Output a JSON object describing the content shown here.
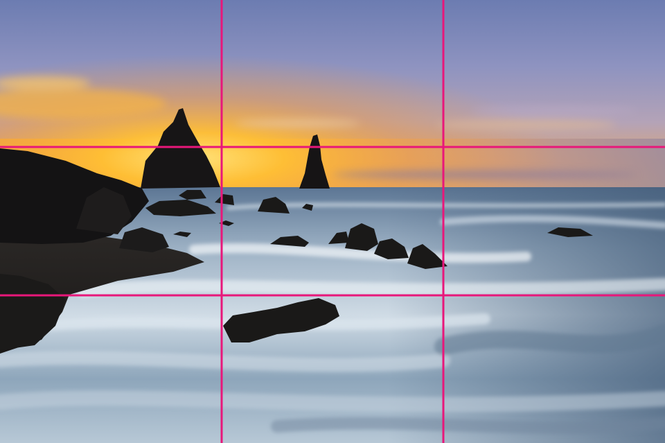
{
  "photo": {
    "subject": "sunset-seascape-with-sea-stacks",
    "colors": {
      "sky_top": "#6f7fb3",
      "sky_mid": "#a9a3c8",
      "sun_glow": "#ffc233",
      "horizon_orange": "#f7a932",
      "sea_light": "#dfe9f0",
      "sea_blue": "#4f6a86",
      "sand_dark": "#24211f",
      "rock": "#141313"
    }
  },
  "overlay": {
    "type": "rule-of-thirds-grid",
    "line_color": "#e8177a",
    "vertical_lines": 2,
    "horizontal_lines": 2
  }
}
